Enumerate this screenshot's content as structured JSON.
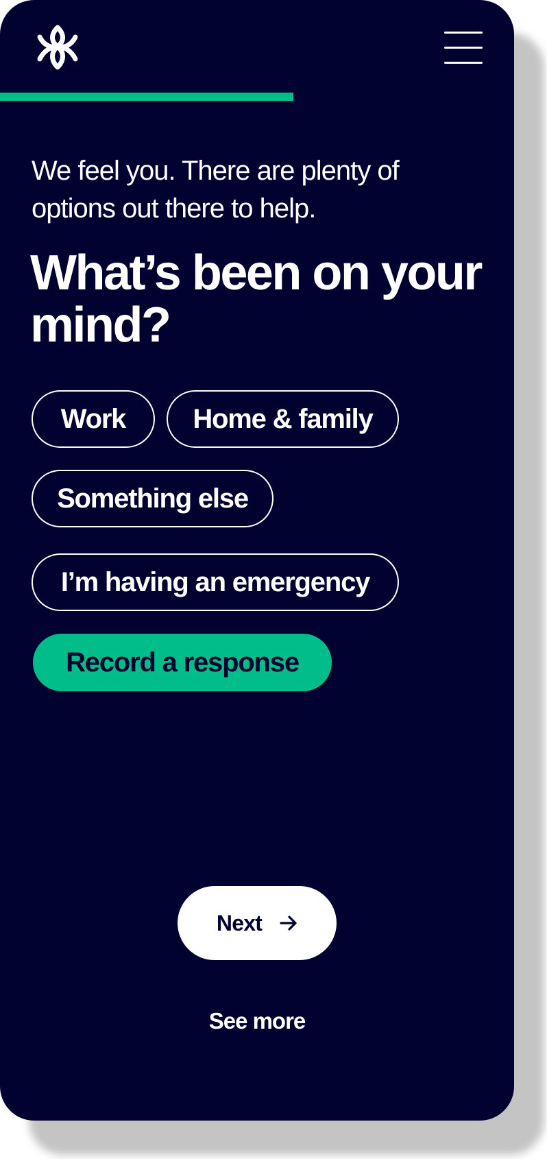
{
  "header": {
    "logo_icon": "lotus-flower-icon",
    "menu_icon": "hamburger-menu-icon"
  },
  "progress": {
    "fraction": 0.57,
    "color": "#00bd8a"
  },
  "intro_text": "We feel you. There are plenty of options out there to help.",
  "headline": "What’s been on your mind?",
  "options": {
    "work": "Work",
    "home_family": "Home & family",
    "something_else": "Something else",
    "emergency": "I’m having an emergency"
  },
  "record_label": "Record a response",
  "next_label": "Next",
  "next_icon": "arrow-right-icon",
  "see_more_label": "See more",
  "colors": {
    "background": "#020230",
    "accent": "#00bd8a",
    "text": "#ffffff"
  }
}
